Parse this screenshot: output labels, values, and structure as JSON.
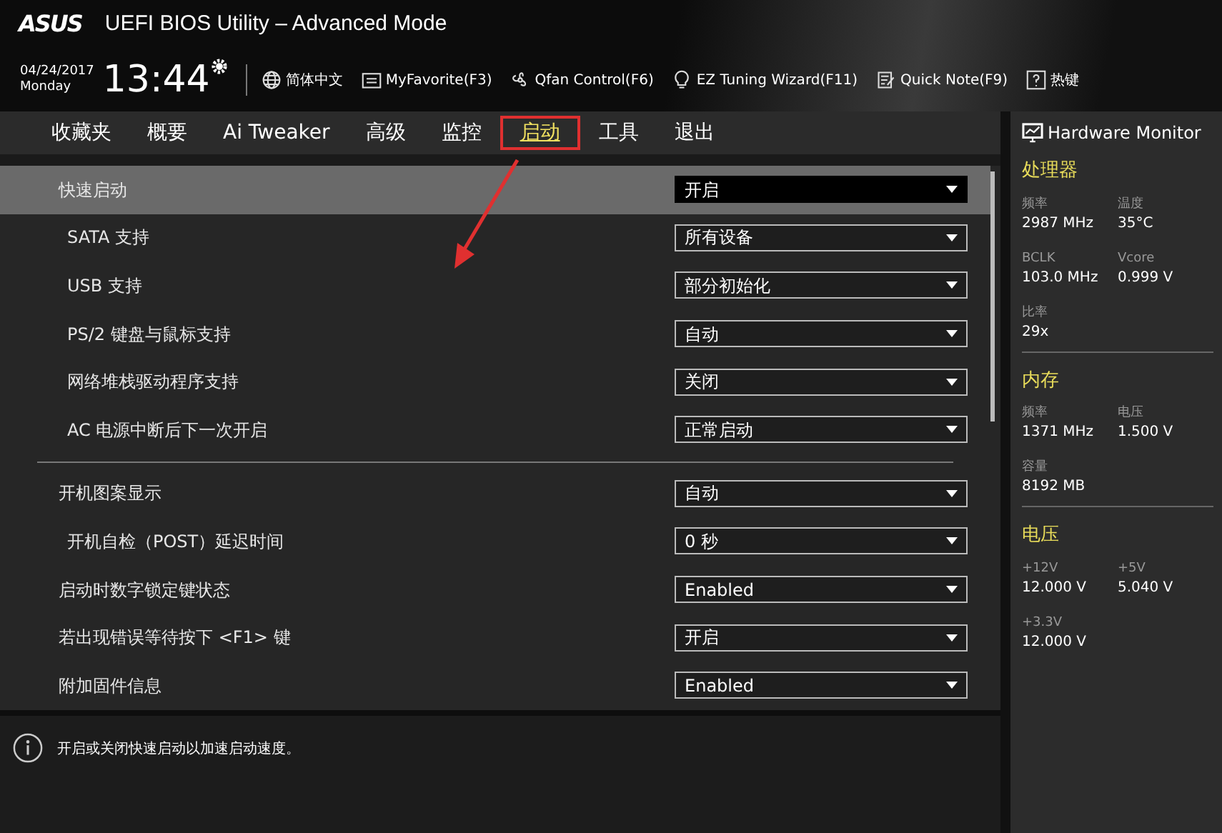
{
  "window": {
    "logo": "ASUS",
    "title": "UEFI BIOS Utility – Advanced Mode"
  },
  "toolbar": {
    "date": "04/24/2017",
    "day": "Monday",
    "time": "13:44",
    "items": [
      {
        "label": "简体中文",
        "kind": "globe"
      },
      {
        "label": "MyFavorite(F3)",
        "kind": "favorite"
      },
      {
        "label": "Qfan Control(F6)",
        "kind": "fan"
      },
      {
        "label": "EZ Tuning Wizard(F11)",
        "kind": "bulb"
      },
      {
        "label": "Quick Note(F9)",
        "kind": "note"
      },
      {
        "label": "热键",
        "kind": "help"
      }
    ]
  },
  "tabs": [
    {
      "label": "收藏夹",
      "selected": false
    },
    {
      "label": "概要",
      "selected": false
    },
    {
      "label": "Ai Tweaker",
      "selected": false
    },
    {
      "label": "高级",
      "selected": false
    },
    {
      "label": "监控",
      "selected": false
    },
    {
      "label": "启动",
      "selected": true
    },
    {
      "label": "工具",
      "selected": false
    },
    {
      "label": "退出",
      "selected": false
    }
  ],
  "settings": [
    {
      "kind": "item",
      "label": "快速启动",
      "value": "开启",
      "selected": true,
      "children": [
        {
          "label": "SATA 支持",
          "value": "所有设备",
          "selected": false
        },
        {
          "label": "USB 支持",
          "value": "部分初始化",
          "selected": false
        },
        {
          "label": "PS/2 键盘与鼠标支持",
          "value": "自动",
          "selected": false
        },
        {
          "label": "网络堆栈驱动程序支持",
          "value": "关闭",
          "selected": false
        },
        {
          "label": "AC 电源中断后下一次开启",
          "value": "正常启动",
          "selected": false
        }
      ]
    },
    {
      "kind": "divider"
    },
    {
      "kind": "item",
      "label": "开机图案显示",
      "value": "自动",
      "selected": false,
      "children": [
        {
          "label": "开机自检（POST）延迟时间",
          "value": "0 秒",
          "selected": false
        }
      ]
    },
    {
      "kind": "item",
      "label": "启动时数字锁定键状态",
      "value": "Enabled",
      "selected": false
    },
    {
      "kind": "item",
      "label": "若出现错误等待按下 <F1> 键",
      "value": "开启",
      "selected": false
    },
    {
      "kind": "item",
      "label": "附加固件信息",
      "value": "Enabled",
      "selected": false
    }
  ],
  "help_text": "开启或关闭快速启动以加速启动速度。",
  "hardware_monitor": {
    "title": "Hardware Monitor",
    "sections": [
      {
        "title": "处理器",
        "readings": [
          {
            "label": "频率",
            "value": "2987 MHz"
          },
          {
            "label": "温度",
            "value": "35°C"
          },
          {
            "label": "BCLK",
            "value": "103.0 MHz"
          },
          {
            "label": "Vcore",
            "value": "0.999 V"
          },
          {
            "label": "比率",
            "value": "29x"
          }
        ]
      },
      {
        "title": "内存",
        "readings": [
          {
            "label": "频率",
            "value": "1371 MHz"
          },
          {
            "label": "电压",
            "value": "1.500 V"
          },
          {
            "label": "容量",
            "value": "8192 MB"
          }
        ]
      },
      {
        "title": "电压",
        "readings": [
          {
            "label": "+12V",
            "value": "12.000 V"
          },
          {
            "label": "+5V",
            "value": "5.040 V"
          },
          {
            "label": "+3.3V",
            "value": "12.000 V"
          }
        ]
      }
    ]
  }
}
